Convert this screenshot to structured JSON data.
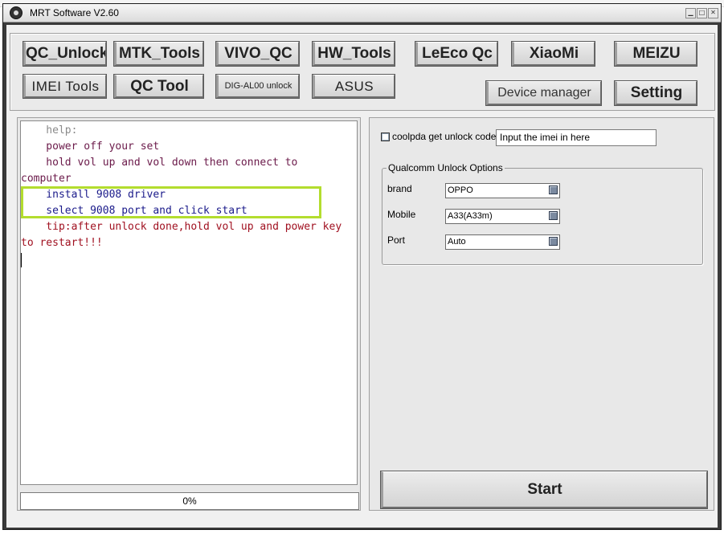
{
  "window": {
    "title": "MRT Software V2.60"
  },
  "toolbar": {
    "qc_unlock": "QC_Unlock",
    "mtk_tools": "MTK_Tools",
    "vivo_qc": "VIVO_QC",
    "hw_tools": "HW_Tools",
    "leeco_qc": "LeEco Qc",
    "xiaomi": "XiaoMi",
    "meizu": "MEIZU",
    "imei_tools": "IMEI Tools",
    "qc_tool": "QC Tool",
    "dig_al00": "DIG-AL00 unlock",
    "asus": "ASUS",
    "device_manager": "Device manager",
    "setting": "Setting"
  },
  "log": {
    "lines": [
      "    help:",
      "    power off your set",
      "    hold vol up and vol down then connect to",
      "computer",
      "    install 9008 driver",
      "    select 9008 port and click start",
      "    tip:after unlock done,hold vol up and power key",
      "to restart!!!"
    ]
  },
  "progress": {
    "label": "0%",
    "value": 0
  },
  "right": {
    "coolpda_label": "coolpda get unlock code",
    "coolpda_checked": false,
    "imei_value": "Input the imei in here",
    "group_title": "Qualcomm Unlock Options",
    "brand_label": "brand",
    "brand_value": "OPPO",
    "mobile_label": "Mobile",
    "mobile_value": "A33(A33m)",
    "port_label": "Port",
    "port_value": "Auto",
    "start_label": "Start"
  },
  "colors": {
    "highlight_box": "#b3dd2e",
    "log_text": "#6b1a4a",
    "log_help": "#8a8a8a",
    "log_steps": "#1a1a8a",
    "log_tip": "#a01020"
  }
}
